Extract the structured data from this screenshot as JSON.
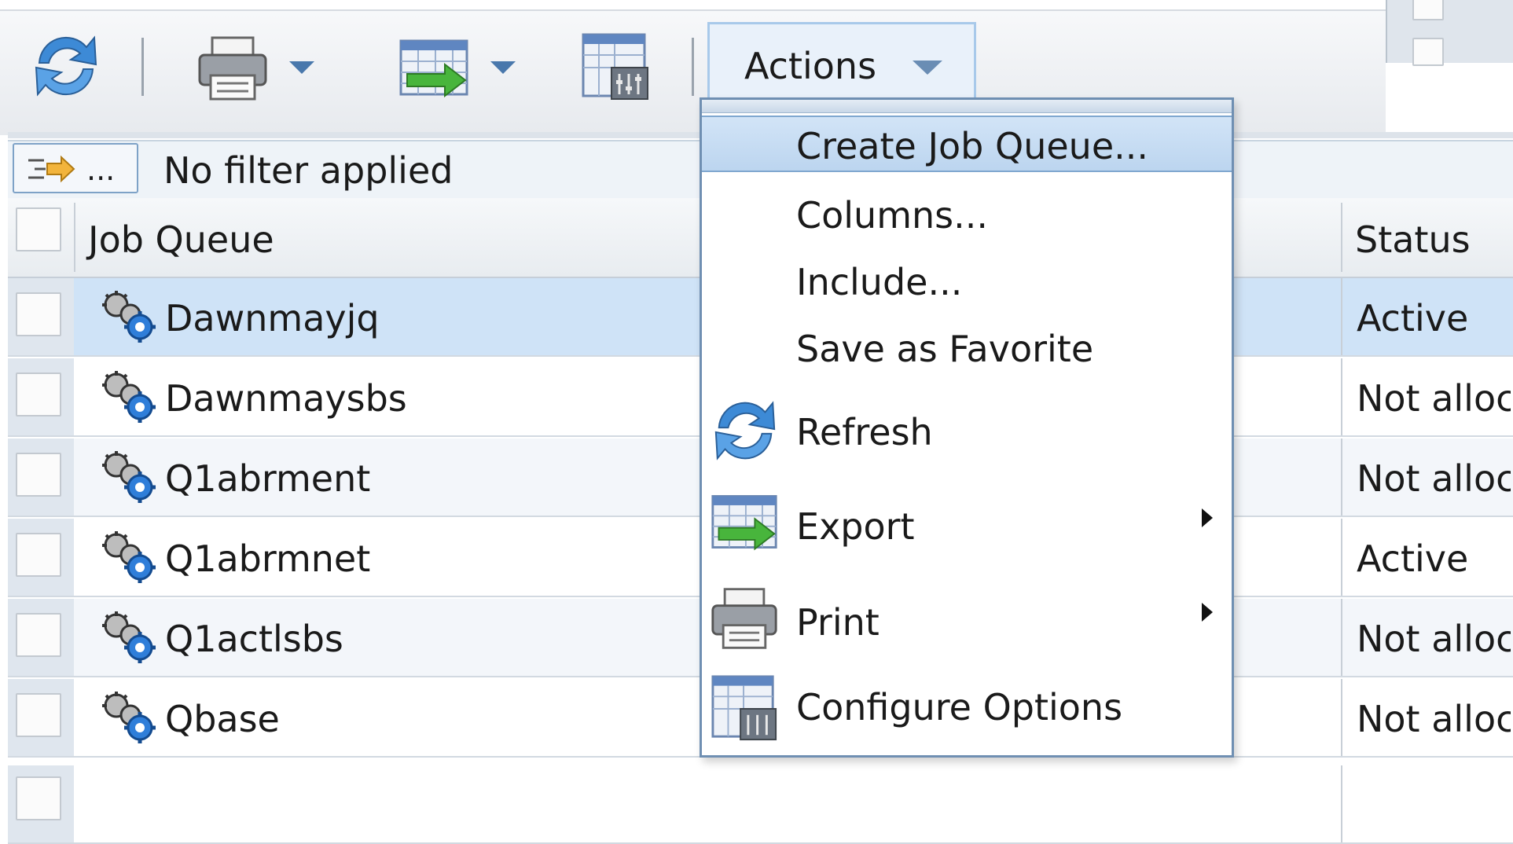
{
  "toolbar": {
    "refresh_icon": "refresh-icon",
    "print_icon": "printer-icon",
    "export_icon": "export-icon",
    "configure_icon": "configure-options-icon",
    "actions_label": "Actions"
  },
  "filter": {
    "button_label": "...",
    "text": "No filter applied"
  },
  "table": {
    "columns": [
      "Job Queue",
      "Status"
    ],
    "rows": [
      {
        "name": "Dawnmayjq",
        "status": "Active",
        "selected": true
      },
      {
        "name": "Dawnmaysbs",
        "status": "Not alloc",
        "selected": false
      },
      {
        "name": "Q1abrment",
        "status": "Not alloc",
        "selected": false
      },
      {
        "name": "Q1abrmnet",
        "status": "Active",
        "selected": false
      },
      {
        "name": "Q1actlsbs",
        "status": "Not alloc",
        "selected": false
      },
      {
        "name": "Qbase",
        "status": "Not alloc",
        "selected": false
      }
    ]
  },
  "actions_menu": {
    "items": [
      {
        "label": "Create Job Queue...",
        "icon": "",
        "submenu": false,
        "highlighted": true
      },
      {
        "label": "Columns...",
        "icon": "",
        "submenu": false
      },
      {
        "label": "Include...",
        "icon": "",
        "submenu": false
      },
      {
        "label": "Save as Favorite",
        "icon": "",
        "submenu": false
      },
      {
        "label": "Refresh",
        "icon": "refresh-icon",
        "submenu": false
      },
      {
        "label": "Export",
        "icon": "export-icon",
        "submenu": true
      },
      {
        "label": "Print",
        "icon": "printer-icon",
        "submenu": true
      },
      {
        "label": "Configure Options",
        "icon": "configure-options-icon",
        "submenu": false
      }
    ]
  },
  "colors": {
    "selected_row": "#cfe3f7",
    "row_alt": "#f3f6fa",
    "accent": "#4978ac"
  }
}
